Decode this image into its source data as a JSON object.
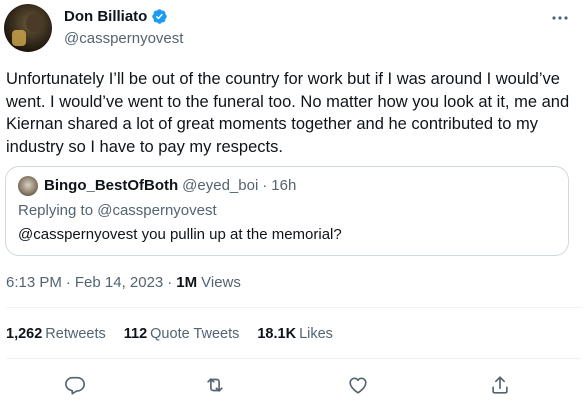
{
  "author": {
    "display_name": "Don Billiato",
    "handle": "@casspernyovest",
    "verified": true
  },
  "tweet": {
    "text": "Unfortunately I’ll be out of the country for work but if I was around I would’ve went. I would’ve went to the funeral too. No matter how you look at it, me and Kiernan shared a lot of great moments together and he contributed to my industry so I have to pay my respects."
  },
  "quoted_tweet": {
    "display_name": "Bingo_BestOfBoth",
    "handle": "@eyed_boi",
    "separator": "·",
    "time_ago": "16h",
    "replying_to_label": "Replying to",
    "replying_to_handle": "@casspernyovest",
    "text": "@casspernyovest you pullin up at the memorial?"
  },
  "meta": {
    "time": "6:13 PM",
    "separator": "·",
    "date": "Feb 14, 2023",
    "separator2": "·",
    "views_count": "1M",
    "views_label": "Views"
  },
  "stats": {
    "retweets_count": "1,262",
    "retweets_label": "Retweets",
    "quotes_count": "112",
    "quotes_label": "Quote Tweets",
    "likes_count": "18.1K",
    "likes_label": "Likes"
  },
  "actions": {
    "reply_icon": "reply-icon",
    "retweet_icon": "retweet-icon",
    "like_icon": "heart-icon",
    "share_icon": "share-icon"
  },
  "colors": {
    "primary_text": "#0f1419",
    "secondary_text": "#536471",
    "verified_blue": "#1d9bf0",
    "border": "#cfd9de"
  }
}
